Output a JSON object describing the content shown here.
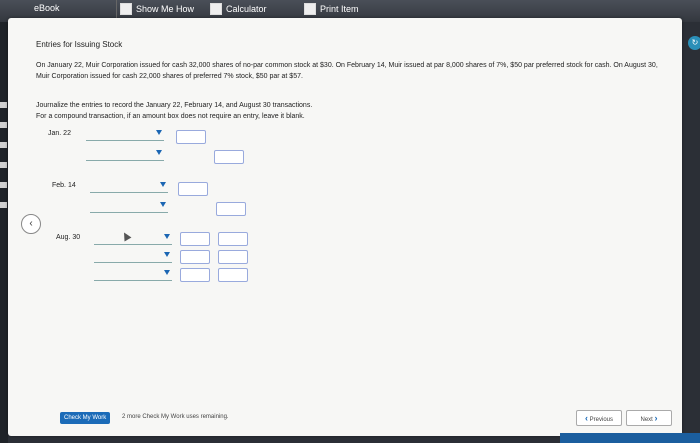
{
  "toolbar": {
    "ebook": "eBook",
    "show_me_how": "Show Me How",
    "calculator": "Calculator",
    "print_item": "Print Item"
  },
  "content": {
    "title": "Entries for Issuing Stock",
    "problem": "On January 22, Muir Corporation issued for cash 32,000 shares of no-par common stock at $30. On February 14, Muir issued at par 8,000 shares of 7%, $50 par preferred stock for cash. On August 30, Muir Corporation issued for cash 22,000 shares of preferred 7% stock, $50 par at $57.",
    "instruction1": "Journalize the entries to record the January 22, February 14, and August 30 transactions.",
    "instruction2": "For a compound transaction, if an amount box does not require an entry, leave it blank."
  },
  "entries": {
    "jan": "Jan. 22",
    "feb": "Feb. 14",
    "aug": "Aug. 30"
  },
  "footer": {
    "check_my_work": "Check My Work",
    "remaining": "2 more Check My Work uses remaining.",
    "previous": "Previous",
    "next": "Next"
  }
}
